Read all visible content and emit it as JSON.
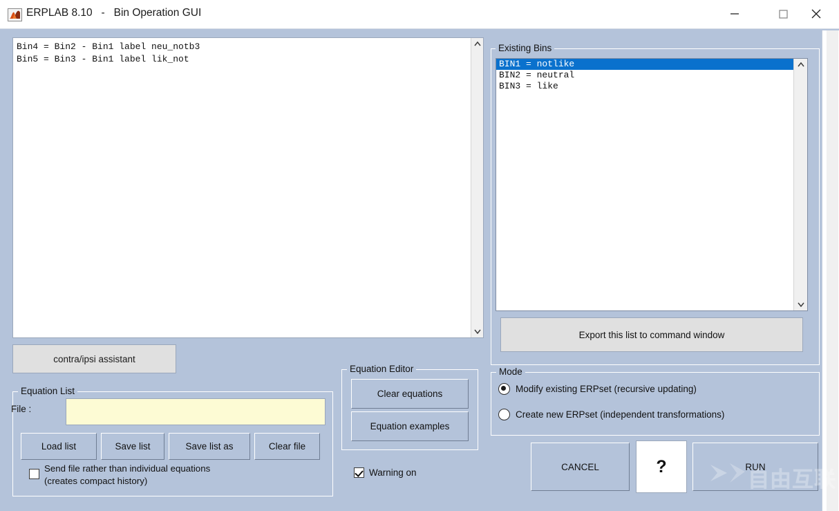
{
  "window": {
    "app_title": "ERPLAB 8.10",
    "separator": "-",
    "doc_title": "Bin Operation GUI",
    "title_full": "ERPLAB 8.10   -   Bin Operation GUI",
    "icon": "matlab-membrane-icon",
    "controls": {
      "minimize": "minimize-icon",
      "maximize": "maximize-icon",
      "close": "close-icon"
    }
  },
  "equation_area": {
    "lines": [
      "Bin4 = Bin2 - Bin1 label neu_notb3",
      "Bin5 = Bin3 - Bin1 label lik_not"
    ],
    "text": "Bin4 = Bin2 - Bin1 label neu_notb3\nBin5 = Bin3 - Bin1 label lik_not",
    "scrollbar": {
      "up": "chevron-up-icon",
      "down": "chevron-down-icon"
    }
  },
  "contra_ipsi": {
    "label": "contra/ipsi assistant"
  },
  "equation_list": {
    "group_title": "Equation List",
    "file_label": "File :",
    "file_value": "",
    "file_placeholder": "",
    "buttons": {
      "load": "Load list",
      "save": "Save list",
      "save_as": "Save list as",
      "clear": "Clear file"
    },
    "send_file_checkbox": {
      "label": "Send file rather than individual equations\n(creates compact history)",
      "checked": false
    }
  },
  "equation_editor": {
    "group_title": "Equation Editor",
    "clear_equations": "Clear equations",
    "equation_examples": "Equation examples",
    "warning_checkbox": {
      "label": "Warning on",
      "checked": true
    }
  },
  "existing_bins": {
    "group_title": "Existing Bins",
    "items": [
      {
        "text": "BIN1 = notlike",
        "selected": true
      },
      {
        "text": "BIN2 = neutral",
        "selected": false
      },
      {
        "text": "BIN3 = like",
        "selected": false
      }
    ],
    "export_button": "Export this list to command window",
    "scrollbar": {
      "up": "chevron-up-icon",
      "down": "chevron-down-icon"
    }
  },
  "mode": {
    "group_title": "Mode",
    "options": [
      {
        "label": "Modify existing ERPset (recursive updating)",
        "selected": true
      },
      {
        "label": "Create new ERPset (independent transformations)",
        "selected": false
      }
    ]
  },
  "actions": {
    "cancel": "CANCEL",
    "help": "?",
    "run": "RUN"
  },
  "watermark": {
    "text": "自由互联",
    "logo": "x-logo-icon"
  },
  "colors": {
    "window_background": "#b4c3da",
    "titlebar": "#ffffff",
    "selection_blue": "#0a71cd",
    "file_field_yellow": "#fdfbd4",
    "gray_button": "#e0e0e0",
    "text": "#111111"
  }
}
